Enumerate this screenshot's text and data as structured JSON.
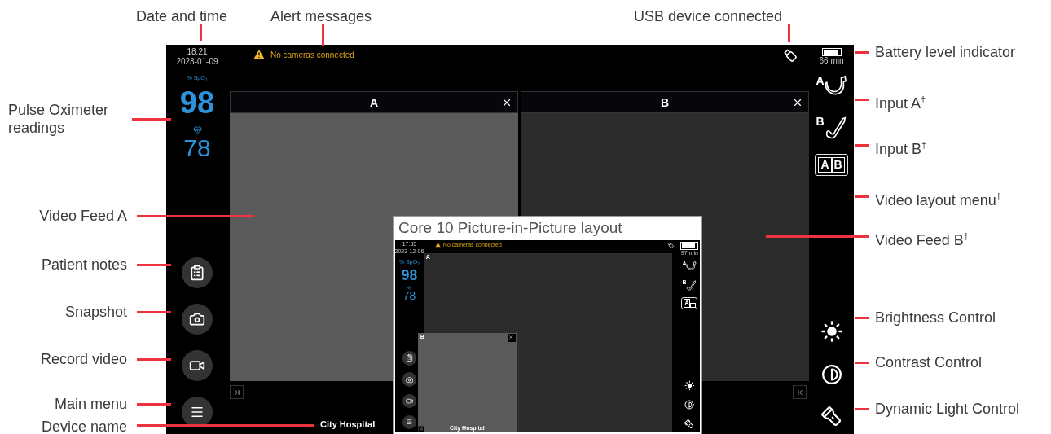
{
  "callouts": {
    "top": [
      {
        "label": "Date and time"
      },
      {
        "label": "Alert messages"
      },
      {
        "label": "USB device connected"
      }
    ],
    "left": [
      {
        "label": "Pulse Oximeter readings"
      },
      {
        "label": "Video Feed A"
      },
      {
        "label": "Patient notes"
      },
      {
        "label": "Snapshot"
      },
      {
        "label": "Record video"
      },
      {
        "label": "Main menu"
      },
      {
        "label": "Device name"
      }
    ],
    "right": [
      {
        "label": "Battery level indicator"
      },
      {
        "label": "Input A$^{†}$"
      },
      {
        "label": "Input B$^{†}$"
      },
      {
        "label": "Video layout menu$^{†}$"
      },
      {
        "label": "Video Feed B$^{†}$"
      },
      {
        "label": "Brightness Control"
      },
      {
        "label": "Contrast Control"
      },
      {
        "label": "Dynamic Light Control"
      }
    ]
  },
  "screen": {
    "time": "18:21",
    "date": "2023-01-09",
    "alert": "No cameras connected",
    "spo2_label": "% SpO$_{2}$",
    "spo2": "98",
    "pulse": "78",
    "battery": {
      "level": 0.9
    },
    "battery_time": "66 min",
    "feeds": [
      {
        "label": "A"
      },
      {
        "label": "B"
      }
    ],
    "device_name": "City Hospital",
    "input_a": "A",
    "input_b": "B",
    "layout_menu": [
      "A",
      "B"
    ]
  },
  "inset": {
    "title": "Core 10 Picture-in-Picture layout",
    "screen": {
      "time": "17:55",
      "date": "2023-12-06",
      "alert": "No cameras connected",
      "spo2_label": "% SpO$_{2}$",
      "spo2": "98",
      "pulse": "78",
      "battery": {
        "level": 0.85
      },
      "battery_time": "97 min",
      "feeds": [
        {
          "label": "A"
        },
        {
          "label": "B"
        }
      ],
      "device_name": "City Hospital",
      "input_a": "A",
      "input_b": "B",
      "layout_menu": [
        "A"
      ]
    }
  }
}
